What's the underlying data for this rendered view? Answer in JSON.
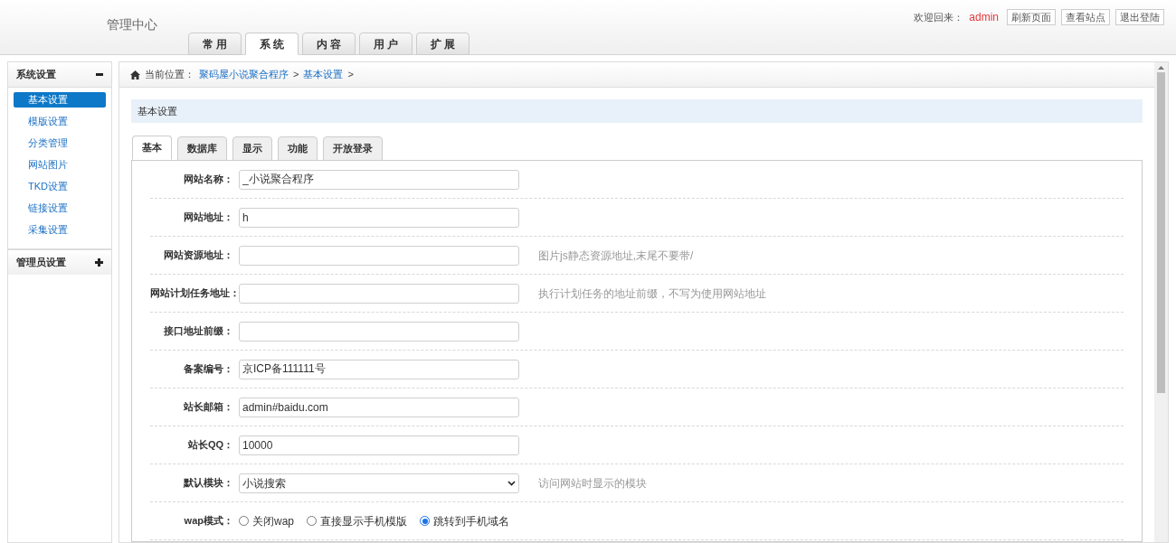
{
  "header": {
    "title": "管理中心",
    "welcome": "欢迎回来：",
    "user": "admin",
    "buttons": [
      "刷新页面",
      "查看站点",
      "退出登陆"
    ]
  },
  "nav_tabs": [
    {
      "label": "常 用",
      "selected": false
    },
    {
      "label": "系 统",
      "selected": true
    },
    {
      "label": "内 容",
      "selected": false
    },
    {
      "label": "用 户",
      "selected": false
    },
    {
      "label": "扩 展",
      "selected": false
    }
  ],
  "sidebar": {
    "groups": [
      {
        "title": "系统设置",
        "expanded": true,
        "items": [
          {
            "label": "基本设置",
            "selected": true
          },
          {
            "label": "模版设置",
            "selected": false
          },
          {
            "label": "分类管理",
            "selected": false
          },
          {
            "label": "网站图片",
            "selected": false
          },
          {
            "label": "TKD设置",
            "selected": false
          },
          {
            "label": "链接设置",
            "selected": false
          },
          {
            "label": "采集设置",
            "selected": false
          }
        ]
      },
      {
        "title": "管理员设置",
        "expanded": false
      }
    ]
  },
  "breadcrumb": {
    "prefix": "当前位置：",
    "links": [
      "聚码屋小说聚合程序",
      "基本设置"
    ],
    "separator": ">"
  },
  "section_title": "基本设置",
  "form_tabs": [
    {
      "label": "基本",
      "selected": true
    },
    {
      "label": "数据库",
      "selected": false
    },
    {
      "label": "显示",
      "selected": false
    },
    {
      "label": "功能",
      "selected": false
    },
    {
      "label": "开放登录",
      "selected": false
    }
  ],
  "form_rows": [
    {
      "kind": "text",
      "label": "网站名称：",
      "value": "_小说聚合程序"
    },
    {
      "kind": "text",
      "label": "网站地址：",
      "value": "h"
    },
    {
      "kind": "text",
      "label": "网站资源地址：",
      "hint": "图片js静态资源地址,末尾不要带/"
    },
    {
      "kind": "text",
      "label": "网站计划任务地址：",
      "hint": "执行计划任务的地址前缀，不写为使用网站地址"
    },
    {
      "kind": "text",
      "label": "接口地址前缀："
    },
    {
      "kind": "text",
      "label": "备案编号：",
      "value": "京ICP备111111号"
    },
    {
      "kind": "text",
      "label": "站长邮箱：",
      "value": "admin#baidu.com"
    },
    {
      "kind": "text",
      "label": "站长QQ：",
      "value": "10000"
    },
    {
      "kind": "select",
      "label": "默认模块：",
      "value": "小说搜索",
      "hint": "访问网站时显示的模块"
    },
    {
      "kind": "radio",
      "label": "wap模式：",
      "options": [
        {
          "label": "关闭wap",
          "selected": false
        },
        {
          "label": "直接显示手机模版",
          "selected": false
        },
        {
          "label": "跳转到手机域名",
          "selected": true
        }
      ]
    }
  ]
}
